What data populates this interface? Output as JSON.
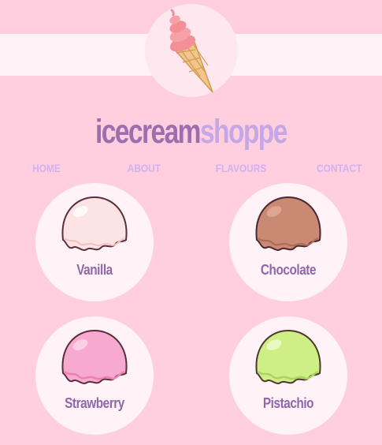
{
  "brand": {
    "part1": "icecream",
    "part2": "shoppe"
  },
  "logo": {
    "icon": "ice-cream-cone-icon"
  },
  "nav": [
    {
      "label": "HOME"
    },
    {
      "label": "ABOUT"
    },
    {
      "label": "FLAVOURS"
    },
    {
      "label": "CONTACT"
    }
  ],
  "flavours": [
    {
      "label": "Vanilla",
      "icon": "vanilla-scoop-icon",
      "color": "#fde4e4"
    },
    {
      "label": "Chocolate",
      "icon": "chocolate-scoop-icon",
      "color": "#c98973"
    },
    {
      "label": "Strawberry",
      "icon": "strawberry-scoop-icon",
      "color": "#f7a9cf"
    },
    {
      "label": "Pistachio",
      "icon": "pistachio-scoop-icon",
      "color": "#cdef86"
    }
  ],
  "colors": {
    "background": "#ffcfe0",
    "band": "#fff2f7",
    "brand_dark": "#9b6fae",
    "brand_light": "#c6a7e6",
    "nav": "#d2b1f0"
  }
}
